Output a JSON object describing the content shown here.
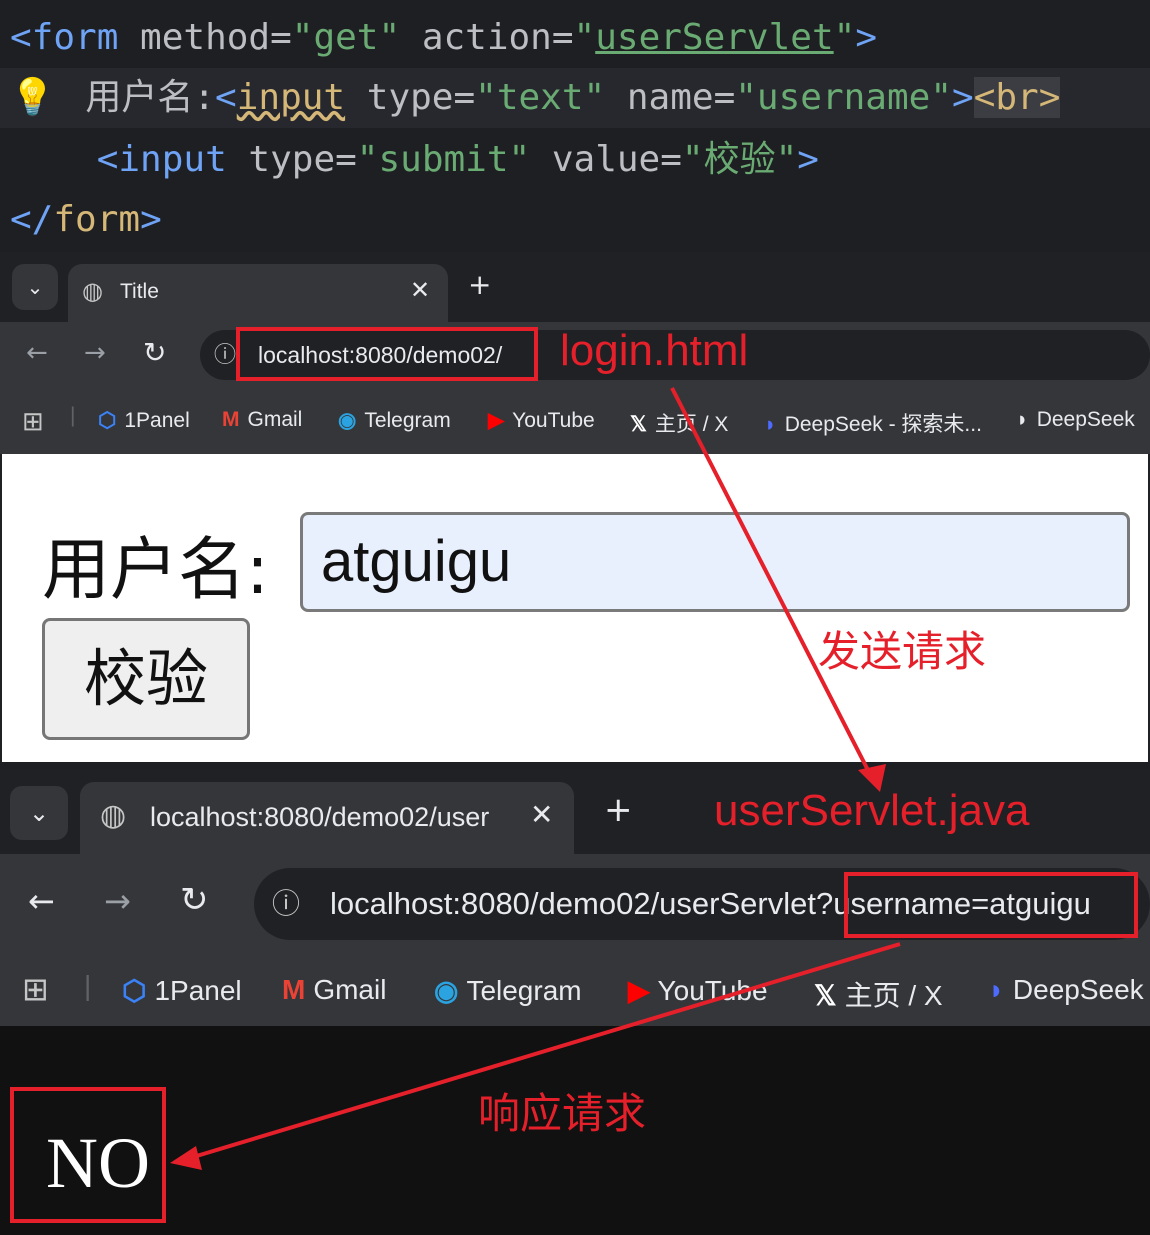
{
  "code": {
    "line1": {
      "open": "<form",
      "a1": " method=",
      "v1": "\"get\"",
      "a2": " action=",
      "v2q1": "\"",
      "v2": "userServlet",
      "v2q2": "\"",
      "close": ">"
    },
    "line2": {
      "label": "用户名:",
      "lt": "<",
      "tag": "input",
      "a1": " type=",
      "v1": "\"text\"",
      "a2": " name=",
      "v2": "\"username\"",
      "gt": ">",
      "br": "<br>"
    },
    "line3": {
      "open": "<input",
      "a1": " type=",
      "v1": "\"submit\"",
      "a2": " value=",
      "v2": "\"校验\"",
      "close": ">"
    },
    "line4": {
      "open": "</",
      "tag": "form",
      "close": ">"
    }
  },
  "browser1": {
    "tab_title": "Title",
    "url": "localhost:8080/demo02/",
    "bookmarks": [
      "1Panel",
      "Gmail",
      "Telegram",
      "YouTube",
      "主页 / X",
      "DeepSeek - 探索未...",
      "DeepSeek"
    ],
    "form_label": "用户名:",
    "input_value": "atguigu",
    "button_label": "校验"
  },
  "browser2": {
    "tab_title": "localhost:8080/demo02/user",
    "url_prefix": "localhost:8080/demo02/userServlet?",
    "url_query": "username=atguigu",
    "bookmarks": [
      "1Panel",
      "Gmail",
      "Telegram",
      "YouTube",
      "主页 / X",
      "DeepSeek"
    ],
    "response_text": "NO"
  },
  "annotations": {
    "login_page": "login.html",
    "send_request": "发送请求",
    "servlet": "userServlet.java",
    "respond": "响应请求",
    "color": "#e5202a"
  }
}
